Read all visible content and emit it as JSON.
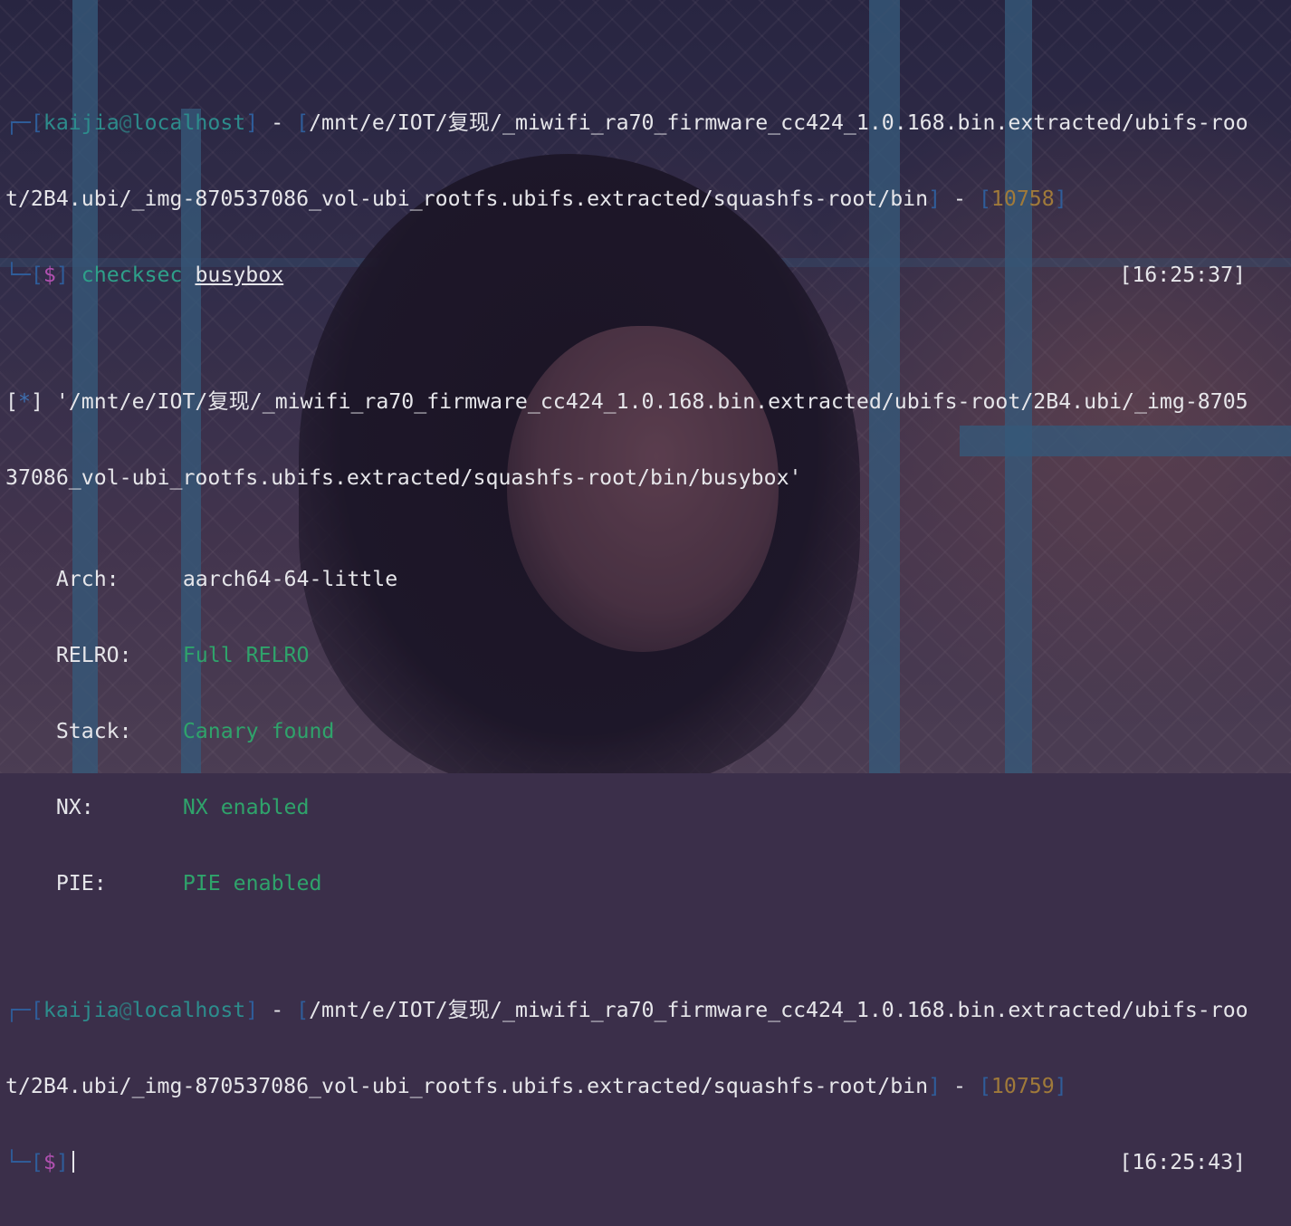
{
  "prompt1": {
    "box_tl": "┌─",
    "lb": "[",
    "user": "kaijia",
    "at": "@",
    "host": "localhost",
    "rb": "]",
    "dash": " - ",
    "path_lb": "[",
    "path_line1": "/mnt/e/IOT/复现/_miwifi_ra70_firmware_cc424_1.0.168.bin.extracted/ubifs-roo",
    "path_line2": "t/2B4.ubi/_img-870537086_vol-ubi_rootfs.ubifs.extracted/squashfs-root/bin",
    "path_rb": "]",
    "hist_lb": "[",
    "hist": "10758",
    "hist_rb": "]",
    "box_bl": "└─",
    "dollar_lb": "[",
    "dollar": "$",
    "dollar_rb": "]",
    "command": "checksec",
    "argument": "busybox",
    "timestamp": "[16:25:37]"
  },
  "output": {
    "info_lb": "[",
    "info_star": "*",
    "info_rb": "]",
    "file_line1": "'/mnt/e/IOT/复现/_miwifi_ra70_firmware_cc424_1.0.168.bin.extracted/ubifs-root/2B4.ubi/_img-8705",
    "file_line2": "37086_vol-ubi_rootfs.ubifs.extracted/squashfs-root/bin/busybox'",
    "rows": [
      {
        "label": "Arch:",
        "value": "aarch64-64-little",
        "colored": false
      },
      {
        "label": "RELRO:",
        "value": "Full RELRO",
        "colored": true
      },
      {
        "label": "Stack:",
        "value": "Canary found",
        "colored": true
      },
      {
        "label": "NX:",
        "value": "NX enabled",
        "colored": true
      },
      {
        "label": "PIE:",
        "value": "PIE enabled",
        "colored": true
      }
    ]
  },
  "prompt2": {
    "box_tl": "┌─",
    "lb": "[",
    "user": "kaijia",
    "at": "@",
    "host": "localhost",
    "rb": "]",
    "dash": " - ",
    "path_lb": "[",
    "path_line1": "/mnt/e/IOT/复现/_miwifi_ra70_firmware_cc424_1.0.168.bin.extracted/ubifs-roo",
    "path_line2": "t/2B4.ubi/_img-870537086_vol-ubi_rootfs.ubifs.extracted/squashfs-root/bin",
    "path_rb": "]",
    "hist_lb": "[",
    "hist": "10759",
    "hist_rb": "]",
    "box_bl": "└─",
    "dollar_lb": "[",
    "dollar": "$",
    "dollar_rb": "]",
    "timestamp": "[16:25:43]"
  }
}
